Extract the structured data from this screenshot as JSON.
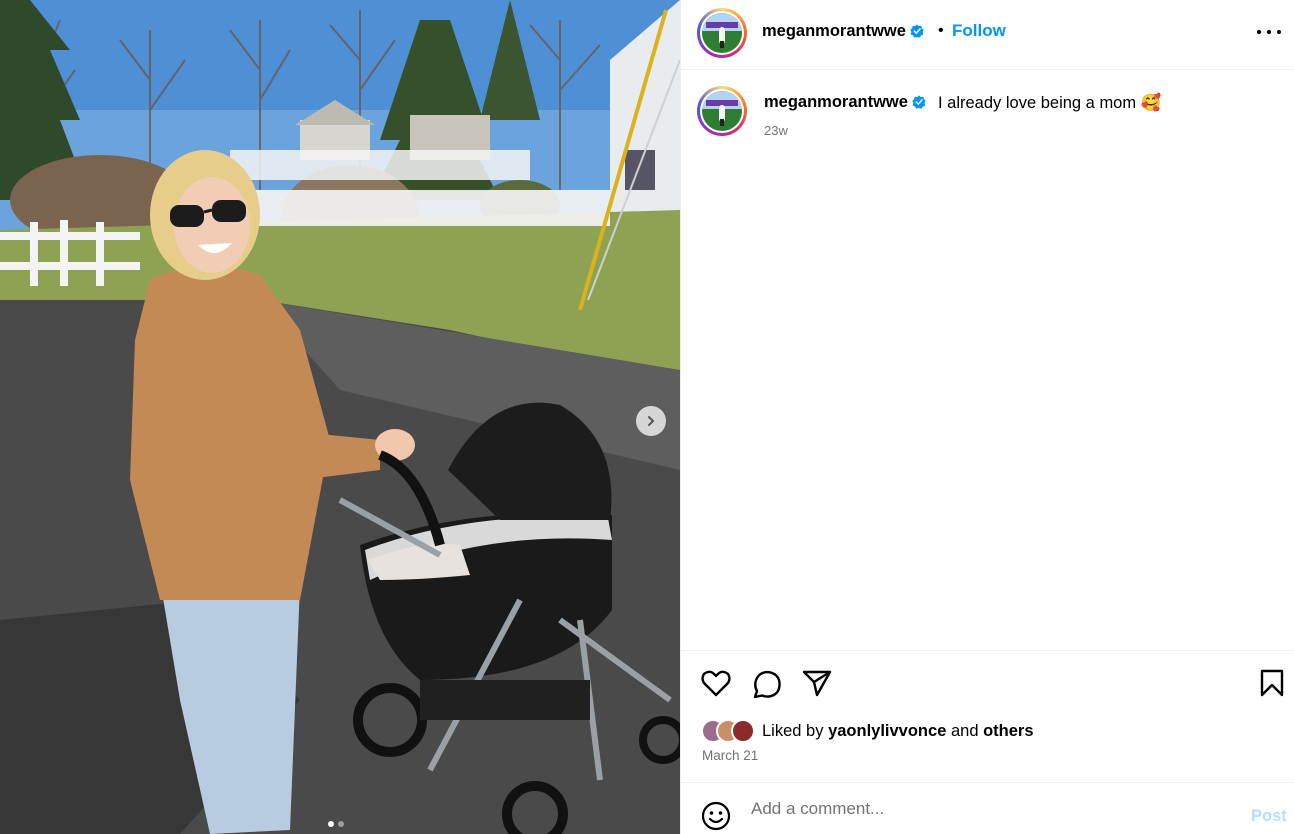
{
  "post": {
    "author": "meganmorantwwe",
    "verified": true,
    "follow_label": "Follow",
    "separator": "•",
    "caption_text": "I already love being a mom 🥰",
    "caption_time": "23w",
    "liked_by_prefix": "Liked by",
    "liked_by_user": "yaonlylivvonce",
    "liked_by_joiner": "and",
    "liked_by_suffix": "others",
    "date": "March 21",
    "carousel": {
      "total": 2,
      "current": 1
    }
  },
  "comment": {
    "placeholder": "Add a comment...",
    "post_label": "Post"
  },
  "icons": {
    "more": "more-horizontal-icon",
    "like": "heart-icon",
    "comment": "comment-bubble-icon",
    "share": "paper-plane-icon",
    "save": "bookmark-icon",
    "emoji": "smiley-icon",
    "next": "chevron-right-icon",
    "verified": "verified-badge-icon"
  },
  "colors": {
    "accent": "#0095f6",
    "post_disabled": "#b2dffc",
    "muted_text": "#737373",
    "divider": "#efefef"
  }
}
